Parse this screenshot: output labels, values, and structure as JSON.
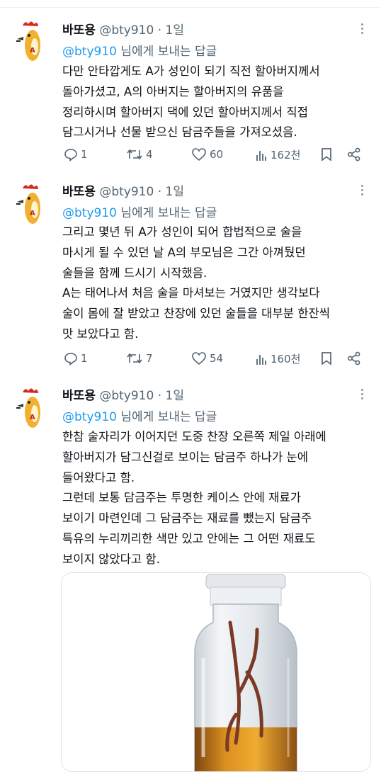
{
  "tweets": [
    {
      "author_name": "바또용",
      "author_handle": "@bty910 · 1일",
      "reply_mention": "@bty910",
      "reply_suffix": " 님에게 보내는 답글",
      "lines": [
        "다만 안타깝게도 A가 성인이 되기 직전 할아버지께서",
        "돌아가셨고, A의 아버지는 할아버지의 유품을",
        "정리하시며 할아버지 댁에 있던 할아버지께서 직접",
        "담그시거나 선물 받으신 담금주들을 가져오셨음."
      ],
      "stats": {
        "replies": "1",
        "retweets": "4",
        "likes": "60",
        "views": "162천"
      }
    },
    {
      "author_name": "바또용",
      "author_handle": "@bty910 · 1일",
      "reply_mention": "@bty910",
      "reply_suffix": " 님에게 보내는 답글",
      "lines": [
        "그리고 몇년 뒤 A가 성인이 되어 합법적으로 술을",
        "마시게 될 수 있던 날 A의 부모님은 그간 아껴뒀던",
        "술들을 함께 드시기 시작했음.",
        "A는 태어나서 처음 술을 마셔보는 거였지만 생각보다",
        "술이 몸에 잘 받았고 찬장에 있던 술들을 대부분 한잔씩",
        "맛 보았다고 함."
      ],
      "stats": {
        "replies": "1",
        "retweets": "7",
        "likes": "54",
        "views": "160천"
      }
    },
    {
      "author_name": "바또용",
      "author_handle": "@bty910 · 1일",
      "reply_mention": "@bty910",
      "reply_suffix": " 님에게 보내는 답글",
      "lines": [
        "한참 술자리가 이어지던 도중 찬장 오른쪽 제일 아래에",
        "할아버지가 담그신걸로 보이는 담금주 하나가 눈에",
        "들어왔다고 함.",
        "그런데 보통 담금주는 투명한 케이스 안에 재료가",
        "보이기 마련인데 그 담금주는 재료를 뺐는지 담금주",
        "특유의 누리끼리한 색만 있고 안에는 그 어떤 재료도",
        "보이지 않았다고 함."
      ]
    }
  ]
}
